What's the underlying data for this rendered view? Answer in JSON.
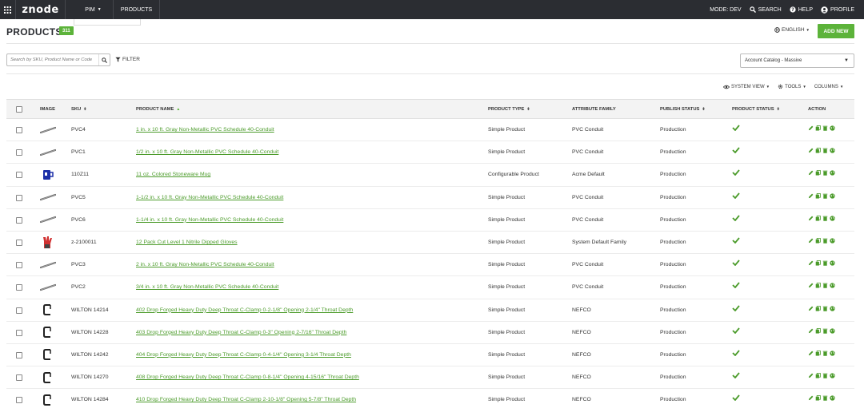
{
  "nav": {
    "logo": "znode",
    "menu_pim": "PIM",
    "menu_products": "PRODUCTS",
    "mode": "MODE: DEV",
    "search": "SEARCH",
    "help": "HELP",
    "profile": "PROFILE"
  },
  "header": {
    "title": "PRODUCTS",
    "count": "311",
    "language": "ENGLISH",
    "add_new": "ADD NEW"
  },
  "toolbar": {
    "search_placeholder": "Search by SKU, Product Name or Code",
    "filter": "FILTER",
    "catalog": "Account Catalog - Massive",
    "system_view": "SYSTEM VIEW",
    "tools": "TOOLS",
    "columns": "COLUMNS"
  },
  "table": {
    "headers": {
      "image": "IMAGE",
      "sku": "SKU",
      "product_name": "PRODUCT NAME",
      "product_type": "PRODUCT TYPE",
      "attribute_family": "ATTRIBUTE FAMILY",
      "publish_status": "PUBLISH STATUS",
      "product_status": "PRODUCT STATUS",
      "action": "ACTION"
    },
    "rows": [
      {
        "image": "pvc-conduit-icon",
        "sku": "PVC4",
        "name": "1 in. x 10 ft. Gray Non-Metallic PVC Schedule 40-Conduit",
        "type": "Simple Product",
        "family": "PVC Conduit",
        "publish": "Production"
      },
      {
        "image": "pvc-conduit-icon",
        "sku": "PVC1",
        "name": "1/2 in. x 10 ft. Gray Non-Metallic PVC Schedule 40-Conduit",
        "type": "Simple Product",
        "family": "PVC Conduit",
        "publish": "Production"
      },
      {
        "image": "mug-icon",
        "sku": "110Z11",
        "name": "11 oz. Colored Stoneware Mug",
        "type": "Configurable Product",
        "family": "Acme Default",
        "publish": "Production"
      },
      {
        "image": "pvc-conduit-icon",
        "sku": "PVC5",
        "name": "1-1/2 in. x 10 ft. Gray Non-Metallic PVC Schedule 40-Conduit",
        "type": "Simple Product",
        "family": "PVC Conduit",
        "publish": "Production"
      },
      {
        "image": "pvc-conduit-icon",
        "sku": "PVC6",
        "name": "1-1/4 in. x 10 ft. Gray Non-Metallic PVC Schedule 40-Conduit",
        "type": "Simple Product",
        "family": "PVC Conduit",
        "publish": "Production"
      },
      {
        "image": "gloves-icon",
        "sku": "z-2100011",
        "name": "12 Pack Cut Level 1 Nitrile Dipped Gloves",
        "type": "Simple Product",
        "family": "System Default Family",
        "publish": "Production"
      },
      {
        "image": "pvc-conduit-icon",
        "sku": "PVC3",
        "name": "2 in. x 10 ft. Gray Non-Metallic PVC Schedule 40-Conduit",
        "type": "Simple Product",
        "family": "PVC Conduit",
        "publish": "Production"
      },
      {
        "image": "pvc-conduit-icon",
        "sku": "PVC2",
        "name": "3/4 in. x 10 ft. Gray Non-Metallic PVC Schedule 40-Conduit",
        "type": "Simple Product",
        "family": "PVC Conduit",
        "publish": "Production"
      },
      {
        "image": "c-clamp-icon",
        "sku": "WILTON 14214",
        "name": "402 Drop Forged Heavy Duty Deep Throat C-Clamp 0-2-1/8\" Opening 2-1/4\" Throat Depth",
        "type": "Simple Product",
        "family": "NEFCO",
        "publish": "Production"
      },
      {
        "image": "c-clamp-icon",
        "sku": "WILTON 14228",
        "name": "403 Drop Forged Heavy Duty Deep Throat C-Clamp 0-3\" Opening 2-7/16\" Throat Depth",
        "type": "Simple Product",
        "family": "NEFCO",
        "publish": "Production"
      },
      {
        "image": "c-clamp-icon",
        "sku": "WILTON 14242",
        "name": "404 Drop Forged Heavy Duty Deep Throat C-Clamp 0-4-1/4\" Opening 3-1/4 Throat Depth",
        "type": "Simple Product",
        "family": "NEFCO",
        "publish": "Production"
      },
      {
        "image": "c-clamp-icon",
        "sku": "WILTON 14270",
        "name": "408 Drop Forged Heavy Duty Deep Throat C-Clamp 0-8-1/4\" Opening 4-15/16\" Throat Depth",
        "type": "Simple Product",
        "family": "NEFCO",
        "publish": "Production"
      },
      {
        "image": "c-clamp-icon",
        "sku": "WILTON 14284",
        "name": "410 Drop Forged Heavy Duty Deep Throat C-Clamp 2-10-1/8\" Opening 5-7/8\" Throat Depth",
        "type": "Simple Product",
        "family": "NEFCO",
        "publish": "Production"
      }
    ]
  },
  "colors": {
    "nav_bg": "#2b2d32",
    "accent_green": "#5cb33a",
    "link_green": "#4b9b2a"
  }
}
